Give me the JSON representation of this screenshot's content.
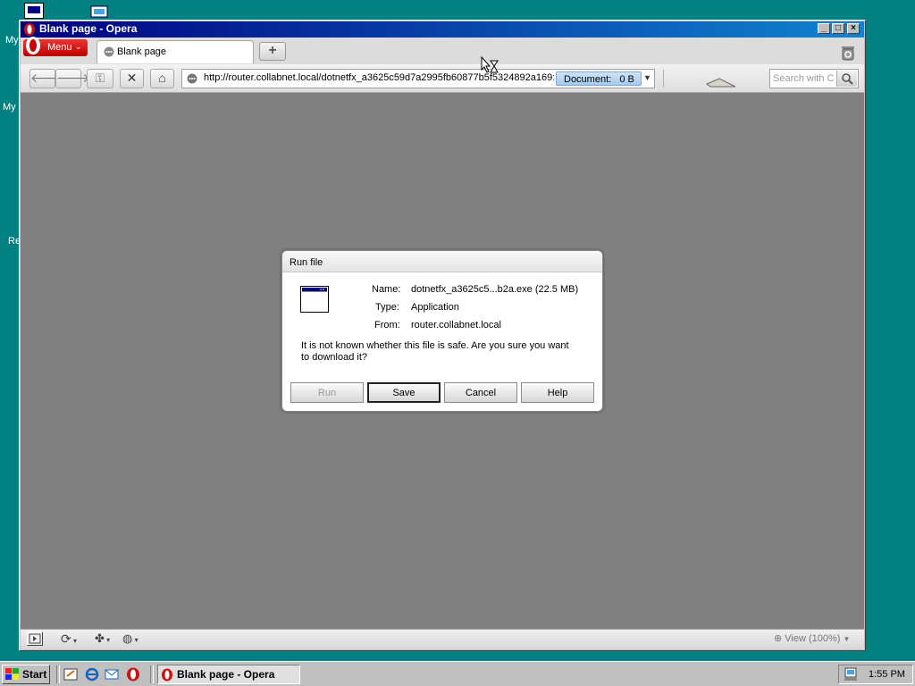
{
  "desktop": {
    "icon_labels": [
      "My",
      "My",
      "Re"
    ]
  },
  "window": {
    "title": "Blank page - Opera",
    "min_glyph": "_",
    "max_glyph": "□",
    "close_glyph": "×"
  },
  "browser": {
    "menu_label": "Menu",
    "tab_title": "Blank page",
    "new_tab_glyph": "+",
    "address_url": "http://router.collabnet.local/dotnetfx_a3625c59d7a2995fb60877b5f5324892a169:",
    "document_badge": "Document:   0 B",
    "search_placeholder": "Search with C",
    "zoom_label": "View (100%)"
  },
  "dialog": {
    "title": "Run file",
    "name_label": "Name:",
    "name_value": "dotnetfx_a3625c5...b2a.exe (22.5 MB)",
    "type_label": "Type:",
    "type_value": "Application",
    "from_label": "From:",
    "from_value": "router.collabnet.local",
    "message_line1": "It is not known whether this file is safe. Are you sure you want",
    "message_line2": "to download it?",
    "buttons": {
      "run": "Run",
      "save": "Save",
      "cancel": "Cancel",
      "help": "Help"
    }
  },
  "taskbar": {
    "start_label": "Start",
    "task_label": "Blank page - Opera",
    "clock": "1:55 PM"
  },
  "colors": {
    "desktop": "#008080",
    "title_bar": "#000080",
    "content_bg": "#808080",
    "opera_red": "#cc1111"
  }
}
